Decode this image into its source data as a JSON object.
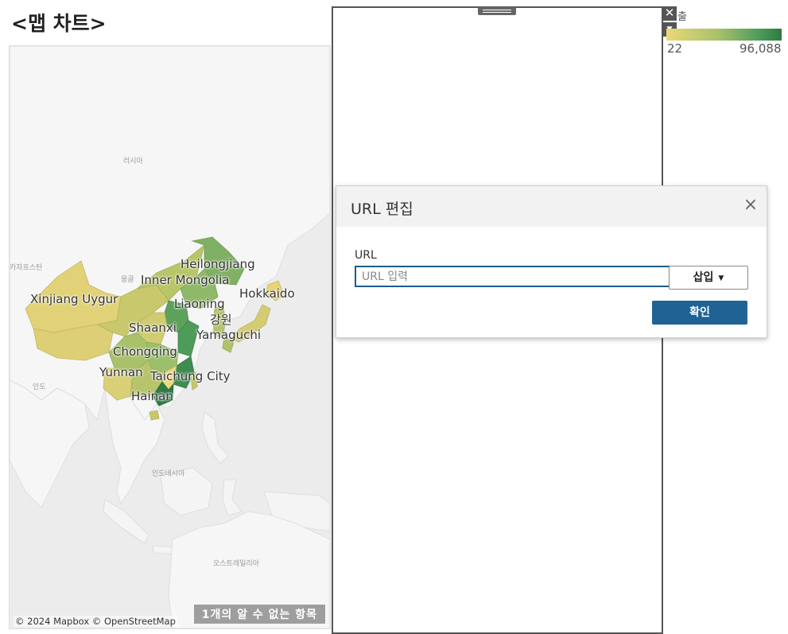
{
  "sheet": {
    "title": "<맵 차트>"
  },
  "map": {
    "country_labels": {
      "russia": "러시아",
      "india": "인도",
      "indonesia": "인도네시아",
      "australia": "오스트레일리아",
      "mongolia": "몽골",
      "kazakhstan": "카자흐스탄"
    },
    "region_labels": {
      "heilongjiang": "Heilongjiang",
      "inner_mongolia": "Inner Mongolia",
      "hokkaido": "Hokkaido",
      "xinjiang": "Xinjiang Uygur",
      "liaoning": "Liaoning",
      "gangwon": "강원",
      "shaanxi": "Shaanxi",
      "yamaguchi": "Yamaguchi",
      "chongqing": "Chongqing",
      "yunnan": "Yunnan",
      "taichung": "Taichung City",
      "hainan": "Hainan"
    },
    "attribution": "© 2024 Mapbox © OpenStreetMap",
    "unknown_items": "1개의 알 수 없는 항목"
  },
  "legend": {
    "title": "출",
    "min_label": "22",
    "max_label": "96,088",
    "min_color": "#e9d878",
    "max_color": "#2e7b44"
  },
  "object_controls": {
    "close_glyph": "✕",
    "menu_glyph": "▼"
  },
  "dialog": {
    "title": "URL 편집",
    "close_glyph": "×",
    "field_label": "URL",
    "url_value": "",
    "url_placeholder": "URL 입력",
    "insert_label": "삽입",
    "insert_caret": "▼",
    "confirm_label": "확인"
  },
  "colors": {
    "map_background": "#eeeeee",
    "land": "#f7f7f7",
    "water": "#e3e3e3",
    "confirm_button": "#1f6395",
    "input_border": "#1f5c8a"
  }
}
